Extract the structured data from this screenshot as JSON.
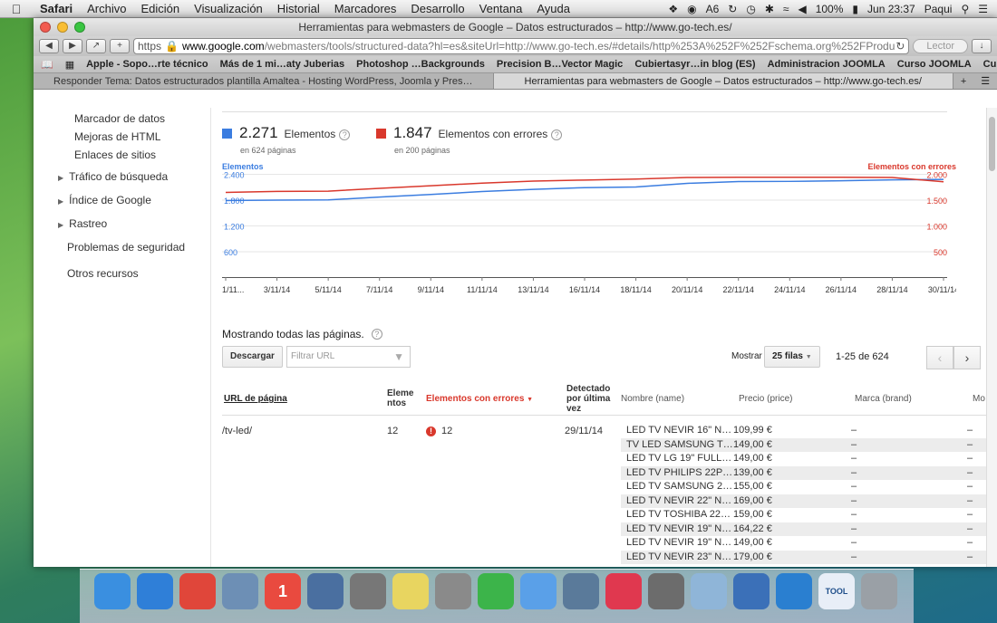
{
  "menubar": {
    "app": "Safari",
    "items": [
      "Archivo",
      "Edición",
      "Visualización",
      "Historial",
      "Marcadores",
      "Desarrollo",
      "Ventana",
      "Ayuda"
    ],
    "status": {
      "adobe_count": "6",
      "battery": "100%",
      "clock": "Jun 23:37",
      "user": "Paqui"
    }
  },
  "window": {
    "title": "Herramientas para webmasters de Google – Datos estructurados – http://www.go-tech.es/",
    "url_scheme": "https",
    "url_host": "www.google.com",
    "url_path": "/webmasters/tools/structured-data?hl=es&siteUrl=http://www.go-tech.es/#details/http%253A%252F%252Fschema.org%252FProduct",
    "reader": "Lector",
    "bookmarks": [
      "Apple - Sopo…rte técnico",
      "Más de 1 mi…aty Juberias",
      "Photoshop …Backgrounds",
      "Precision B…Vector Magic",
      "Cubiertasyr…in blog (ES)",
      "Administracion JOOMLA",
      "Curso JOOMLA",
      "Curso DAW"
    ],
    "tabs": [
      "Responder Tema: Datos estructurados plantilla Amaltea - Hosting WordPress, Joomla y Pres…",
      "Herramientas para webmasters de Google – Datos estructurados – http://www.go-tech.es/"
    ]
  },
  "sidebar": {
    "sub_items": [
      "Marcador de datos",
      "Mejoras de HTML",
      "Enlaces de sitios"
    ],
    "items": [
      "Tráfico de búsqueda",
      "Índice de Google",
      "Rastreo",
      "Problemas de seguridad",
      "Otros recursos"
    ]
  },
  "summary": {
    "elements_count": "2.271",
    "elements_label": "Elementos",
    "elements_sub": "en 624 páginas",
    "errors_count": "1.847",
    "errors_label": "Elementos con errores",
    "errors_sub": "en 200 páginas",
    "help": "?"
  },
  "colors": {
    "elements": "#3b7de0",
    "errors": "#d9382c"
  },
  "chart_data": {
    "type": "line",
    "legend_left": "Elementos",
    "legend_right": "Elementos con errores",
    "x": [
      "1/11...",
      "3/11/14",
      "5/11/14",
      "7/11/14",
      "9/11/14",
      "11/11/14",
      "13/11/14",
      "16/11/14",
      "18/11/14",
      "20/11/14",
      "22/11/14",
      "24/11/14",
      "26/11/14",
      "28/11/14",
      "30/11/14"
    ],
    "y_left_ticks": [
      "2.400",
      "1.800",
      "1.200",
      "600"
    ],
    "y_right_ticks": [
      "2.000",
      "1.500",
      "1.000",
      "500"
    ],
    "y_left_range": [
      0,
      2400
    ],
    "y_right_range": [
      0,
      2000
    ],
    "series": [
      {
        "name": "Elementos",
        "axis": "left",
        "values": [
          1780,
          1790,
          1795,
          1860,
          1920,
          1990,
          2040,
          2080,
          2095,
          2180,
          2220,
          2225,
          2240,
          2260,
          2271
        ]
      },
      {
        "name": "Elementos con errores",
        "axis": "right",
        "values": [
          1640,
          1660,
          1665,
          1720,
          1770,
          1820,
          1860,
          1880,
          1900,
          1930,
          1935,
          1935,
          1935,
          1930,
          1847
        ]
      }
    ]
  },
  "table": {
    "showing": "Mostrando todas las páginas.",
    "download": "Descargar",
    "filter_placeholder": "Filtrar URL",
    "show_label": "Mostrar",
    "rows_select": "25 filas",
    "range": "1-25 de 624",
    "headers": {
      "url": "URL de página",
      "elements": "Elementos",
      "errors": "Elementos con errores",
      "detected": "Detectado por última vez",
      "name": "Nombre (name)",
      "price": "Precio (price)",
      "brand": "Marca (brand)",
      "mo": "Mo"
    },
    "row": {
      "url": "/tv-led/",
      "elements": "12",
      "errors": "12",
      "detected": "29/11/14",
      "items": [
        {
          "name": "LED TV NEVIR 16\" N…",
          "price": "109,99 €",
          "brand": "–",
          "mo": "–"
        },
        {
          "name": "TV LED SAMSUNG T…",
          "price": "149,00 €",
          "brand": "–",
          "mo": "–"
        },
        {
          "name": "LED TV LG 19\" FULL…",
          "price": "149,00 €",
          "brand": "–",
          "mo": "–"
        },
        {
          "name": "LED TV PHILIPS 22P…",
          "price": "139,00 €",
          "brand": "–",
          "mo": "–"
        },
        {
          "name": "LED TV SAMSUNG 2…",
          "price": "155,00 €",
          "brand": "–",
          "mo": "–"
        },
        {
          "name": "LED TV NEVIR 22\" N…",
          "price": "169,00 €",
          "brand": "–",
          "mo": "–"
        },
        {
          "name": "LED TV TOSHIBA 22…",
          "price": "159,00 €",
          "brand": "–",
          "mo": "–"
        },
        {
          "name": "LED TV NEVIR 19\" N…",
          "price": "164,22 €",
          "brand": "–",
          "mo": "–"
        },
        {
          "name": "LED TV NEVIR 19\" N…",
          "price": "149,00 €",
          "brand": "–",
          "mo": "–"
        },
        {
          "name": "LED TV NEVIR 23\" N…",
          "price": "179,00 €",
          "brand": "–",
          "mo": "–"
        }
      ]
    }
  },
  "dock": {
    "apps": [
      {
        "icon": "finder-icon",
        "color": "#3a8fe0"
      },
      {
        "icon": "safari-icon",
        "color": "#2f7fd8"
      },
      {
        "icon": "chrome-icon",
        "color": "#e0463a"
      },
      {
        "icon": "mail-icon",
        "color": "#6d8fb5"
      },
      {
        "icon": "calendar-icon",
        "color": "#e94a3f",
        "label": "1"
      },
      {
        "icon": "book-icon",
        "color": "#4a6fa0"
      },
      {
        "icon": "camera-icon",
        "color": "#777"
      },
      {
        "icon": "notes-icon",
        "color": "#e8d560"
      },
      {
        "icon": "calculator-icon",
        "color": "#8a8a8a"
      },
      {
        "icon": "spotify-icon",
        "color": "#3cb44a"
      },
      {
        "icon": "messages-icon",
        "color": "#5aa0e8"
      },
      {
        "icon": "photos-icon",
        "color": "#5a7a9a"
      },
      {
        "icon": "itunes-icon",
        "color": "#e0384f"
      },
      {
        "icon": "gear-icon",
        "color": "#6c6c6c"
      },
      {
        "icon": "box-icon",
        "color": "#8fb5d8"
      },
      {
        "icon": "virtualbox-icon",
        "color": "#3b70b8"
      },
      {
        "icon": "w-icon",
        "color": "#2a7fd0"
      },
      {
        "icon": "tool-doc-icon",
        "color": "#e8eef7",
        "label": "TOOL"
      },
      {
        "icon": "trash-icon",
        "color": "#9aa0a6"
      }
    ]
  }
}
